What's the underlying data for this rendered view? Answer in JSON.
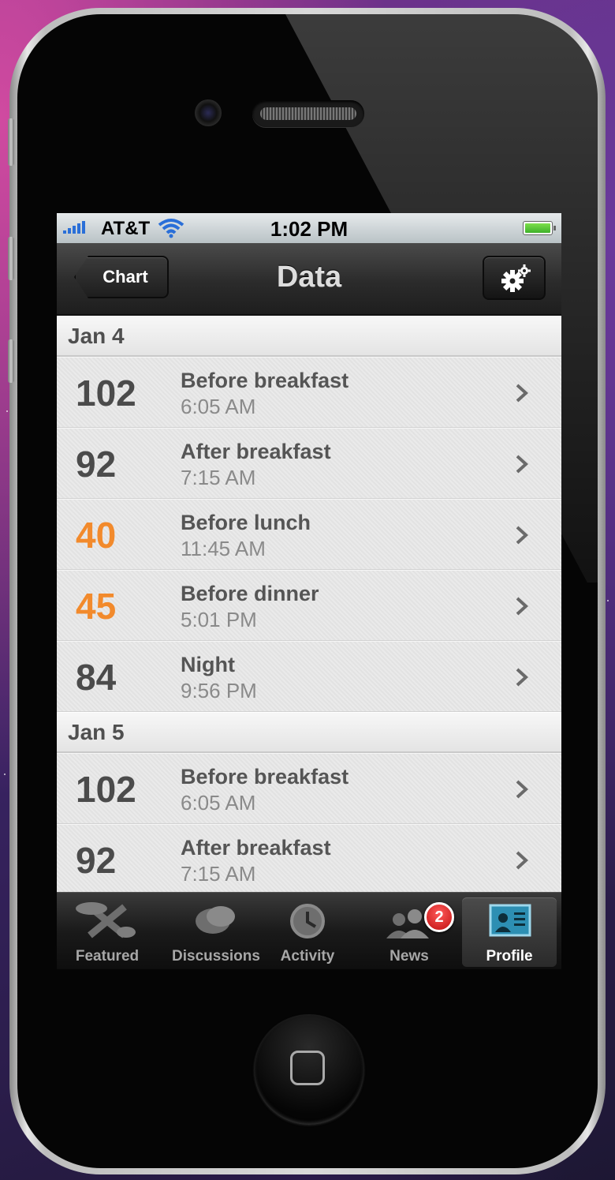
{
  "status": {
    "carrier": "AT&T",
    "time": "1:02 PM",
    "battery": "full"
  },
  "nav": {
    "back_label": "Chart",
    "title": "Data",
    "settings_icon": "gear-icon"
  },
  "sections": [
    {
      "header": "Jan 4",
      "rows": [
        {
          "value": "102",
          "label": "Before breakfast",
          "time": "6:05 AM",
          "status": "normal"
        },
        {
          "value": "92",
          "label": "After breakfast",
          "time": "7:15 AM",
          "status": "normal"
        },
        {
          "value": "40",
          "label": "Before lunch",
          "time": "11:45 AM",
          "status": "low"
        },
        {
          "value": "45",
          "label": "Before dinner",
          "time": "5:01 PM",
          "status": "low"
        },
        {
          "value": "84",
          "label": "Night",
          "time": "9:56 PM",
          "status": "normal"
        }
      ]
    },
    {
      "header": "Jan 5",
      "rows": [
        {
          "value": "102",
          "label": "Before breakfast",
          "time": "6:05 AM",
          "status": "normal"
        },
        {
          "value": "92",
          "label": "After breakfast",
          "time": "7:15 AM",
          "status": "normal"
        }
      ]
    }
  ],
  "tabs": [
    {
      "label": "Featured",
      "icon": "featured-icon"
    },
    {
      "label": "Discussions",
      "icon": "discussions-icon"
    },
    {
      "label": "Activity",
      "icon": "clock-icon"
    },
    {
      "label": "News",
      "icon": "people-icon",
      "badge": "2"
    },
    {
      "label": "Profile",
      "icon": "profile-card-icon",
      "active": true
    }
  ],
  "colors": {
    "low_reading": "#f28a2c",
    "normal_reading": "#4b4b4b",
    "badge": "#d01818"
  }
}
